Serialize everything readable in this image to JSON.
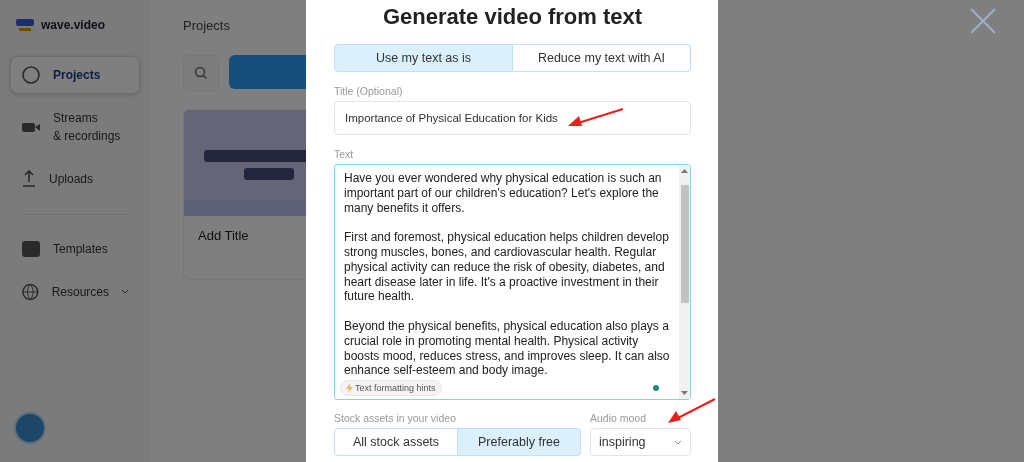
{
  "sidebar": {
    "logo": "wave.video",
    "items": [
      {
        "label": "Projects",
        "selected": true,
        "kind": "grid"
      },
      {
        "label": "Streams\n& recordings",
        "selected": false,
        "kind": "stream"
      },
      {
        "label": "Uploads",
        "selected": false,
        "kind": "upload"
      },
      {
        "label": "Templates",
        "selected": false,
        "kind": "template"
      },
      {
        "label": "Resources",
        "selected": false,
        "kind": "resources",
        "expandable": true
      }
    ]
  },
  "main": {
    "title": "Projects",
    "cards": [
      {
        "kind": "picture",
        "title": "Add Title"
      }
    ]
  },
  "modal": {
    "title": "Generate video from text",
    "modes": [
      {
        "label": "Use my text as is",
        "selected": true
      },
      {
        "label": "Reduce my text with AI",
        "selected": false
      }
    ],
    "title_field": {
      "label": "Title (Optional)",
      "value": "Importance of Physical Education for Kids"
    },
    "text_field": {
      "label": "Text",
      "value": "Have you ever wondered why physical education is such an important part of our children's education? Let's explore the many benefits it offers.\n\nFirst and foremost, physical education helps children develop strong muscles, bones, and cardiovascular health. Regular physical activity can reduce the risk of obesity, diabetes, and heart disease later in life. It's a proactive investment in their future health.\n\nBeyond the physical benefits, physical education also plays a crucial role in promoting mental health. Physical activity boosts mood, reduces stress, and improves sleep. It can also enhance self-esteem and body image.",
      "hint": "Text formatting hints"
    },
    "stock": {
      "label": "Stock assets in your video",
      "options": [
        {
          "label": "All stock assets",
          "selected": false
        },
        {
          "label": "Preferably free",
          "selected": true
        }
      ]
    },
    "audio": {
      "label": "Audio mood",
      "value": "inspiring"
    }
  }
}
